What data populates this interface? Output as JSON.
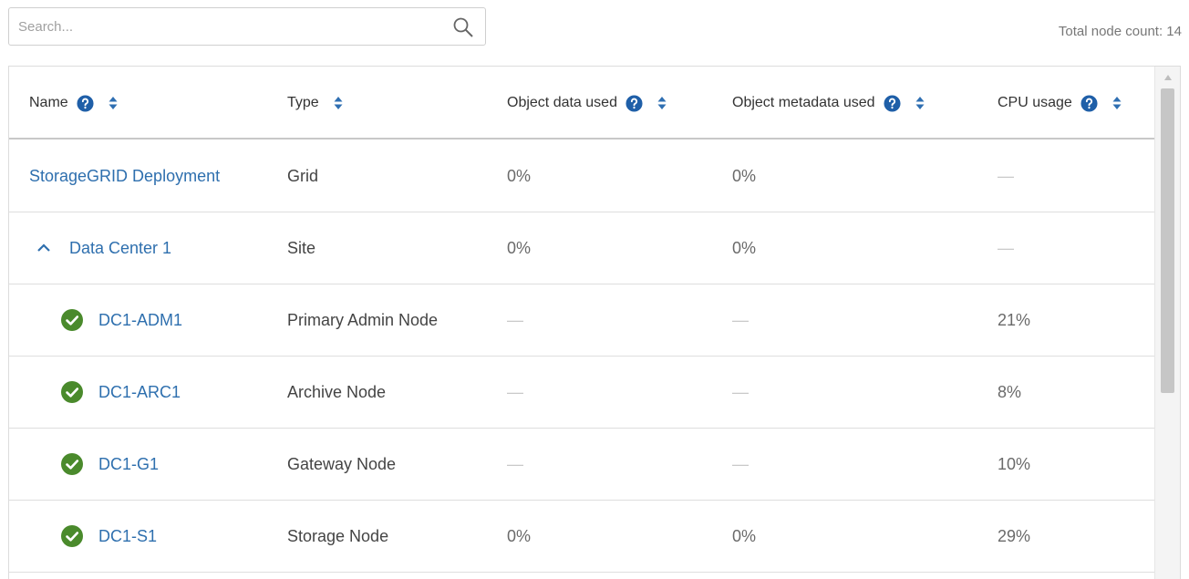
{
  "search": {
    "placeholder": "Search...",
    "value": ""
  },
  "total_node_count": "Total node count: 14",
  "columns": [
    {
      "label": "Name",
      "help": true
    },
    {
      "label": "Type",
      "help": false
    },
    {
      "label": "Object data used",
      "help": true
    },
    {
      "label": "Object metadata used",
      "help": true
    },
    {
      "label": "CPU usage",
      "help": true
    }
  ],
  "rows": [
    {
      "name": "StorageGRID Deployment",
      "type": "Grid",
      "object_data": "0%",
      "object_metadata": "0%",
      "cpu": "—",
      "level": "grid"
    },
    {
      "name": "Data Center 1",
      "type": "Site",
      "object_data": "0%",
      "object_metadata": "0%",
      "cpu": "—",
      "level": "site"
    },
    {
      "name": "DC1-ADM1",
      "type": "Primary Admin Node",
      "object_data": "—",
      "object_metadata": "—",
      "cpu": "21%",
      "level": "node",
      "status": "ok"
    },
    {
      "name": "DC1-ARC1",
      "type": "Archive Node",
      "object_data": "—",
      "object_metadata": "—",
      "cpu": "8%",
      "level": "node",
      "status": "ok"
    },
    {
      "name": "DC1-G1",
      "type": "Gateway Node",
      "object_data": "—",
      "object_metadata": "—",
      "cpu": "10%",
      "level": "node",
      "status": "ok"
    },
    {
      "name": "DC1-S1",
      "type": "Storage Node",
      "object_data": "0%",
      "object_metadata": "0%",
      "cpu": "29%",
      "level": "node",
      "status": "ok"
    }
  ],
  "colors": {
    "link": "#2e6fae",
    "help_icon": "#1f5fa8",
    "sort_icon": "#2f6fb2",
    "status_ok": "#4a8a2c"
  },
  "icons": {
    "search": "search-icon",
    "help": "question-circle-icon",
    "sort": "sort-icon",
    "expand": "chevron-up-icon",
    "status": "check-circle-icon"
  }
}
